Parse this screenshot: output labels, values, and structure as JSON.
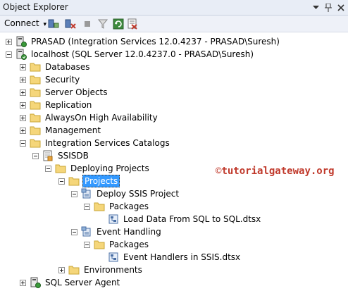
{
  "window": {
    "title": "Object Explorer"
  },
  "toolbar": {
    "connect_label": "Connect",
    "connect_arrow": "▾"
  },
  "tree": {
    "prasad": "PRASAD (Integration Services 12.0.4237 - PRASAD\\Suresh)",
    "localhost": "localhost (SQL Server 12.0.4237.0 - PRASAD\\Suresh)",
    "databases": "Databases",
    "security": "Security",
    "server_objects": "Server Objects",
    "replication": "Replication",
    "alwayson": "AlwaysOn High Availability",
    "management": "Management",
    "isc": "Integration Services Catalogs",
    "ssisdb": "SSISDB",
    "deploying_projects": "Deploying Projects",
    "projects": "Projects",
    "deploy_ssis_project": "Deploy SSIS Project",
    "packages_1": "Packages",
    "load_data": "Load Data From SQL to SQL.dtsx",
    "event_handling": "Event Handling",
    "packages_2": "Packages",
    "event_handlers": "Event Handlers in SSIS.dtsx",
    "environments": "Environments",
    "sql_server_agent": "SQL Server Agent"
  },
  "watermark": {
    "symbol": "©",
    "text": "tutorialgateway.org"
  }
}
